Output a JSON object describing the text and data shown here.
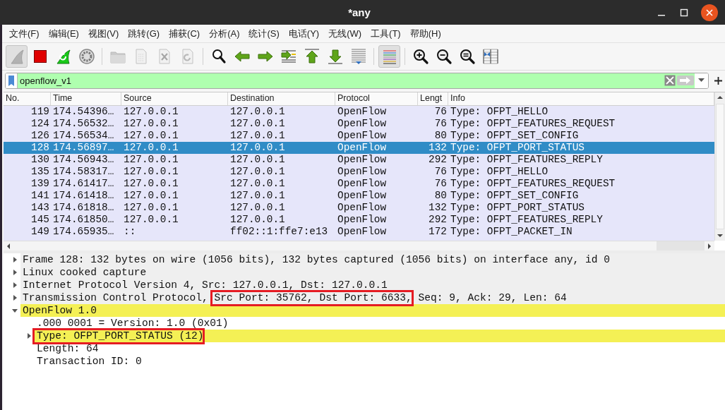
{
  "window": {
    "title": "*any"
  },
  "menu": [
    "文件(F)",
    "编辑(E)",
    "视图(V)",
    "跳转(G)",
    "捕获(C)",
    "分析(A)",
    "统计(S)",
    "电话(Y)",
    "无线(W)",
    "工具(T)",
    "帮助(H)"
  ],
  "toolbar": [
    {
      "kind": "start",
      "pressed": true,
      "disabled": true
    },
    {
      "kind": "stop",
      "pressed": false,
      "disabled": false
    },
    {
      "kind": "restart",
      "pressed": false,
      "disabled": false
    },
    {
      "kind": "options",
      "pressed": false,
      "disabled": false
    },
    {
      "kind": "separator"
    },
    {
      "kind": "open",
      "pressed": false,
      "disabled": true
    },
    {
      "kind": "save",
      "pressed": false,
      "disabled": true
    },
    {
      "kind": "close",
      "pressed": false,
      "disabled": true
    },
    {
      "kind": "reload",
      "pressed": false,
      "disabled": true
    },
    {
      "kind": "separator"
    },
    {
      "kind": "find",
      "pressed": false,
      "disabled": false
    },
    {
      "kind": "back",
      "pressed": false,
      "disabled": false
    },
    {
      "kind": "forward",
      "pressed": false,
      "disabled": false
    },
    {
      "kind": "goto",
      "pressed": false,
      "disabled": false
    },
    {
      "kind": "first",
      "pressed": false,
      "disabled": false
    },
    {
      "kind": "last",
      "pressed": false,
      "disabled": false
    },
    {
      "kind": "autoscroll",
      "pressed": false,
      "disabled": false
    },
    {
      "kind": "separator"
    },
    {
      "kind": "colorize",
      "pressed": true,
      "disabled": false
    },
    {
      "kind": "separator"
    },
    {
      "kind": "zoom-in",
      "pressed": false,
      "disabled": false
    },
    {
      "kind": "zoom-out",
      "pressed": false,
      "disabled": false
    },
    {
      "kind": "zoom-normal",
      "pressed": false,
      "disabled": false
    },
    {
      "kind": "resize-columns",
      "pressed": false,
      "disabled": false
    }
  ],
  "filter": {
    "value": "openflow_v1",
    "valid": true
  },
  "packet_list": {
    "columns": [
      "No.",
      "Time",
      "Source",
      "Destination",
      "Protocol",
      "Lengt",
      "Info"
    ],
    "rows": [
      {
        "cells": [
          "119",
          "174.54396…",
          "127.0.0.1",
          "127.0.0.1",
          "OpenFlow",
          "76",
          "Type: OFPT_HELLO"
        ],
        "selected": false
      },
      {
        "cells": [
          "124",
          "174.56532…",
          "127.0.0.1",
          "127.0.0.1",
          "OpenFlow",
          "76",
          "Type: OFPT_FEATURES_REQUEST"
        ],
        "selected": false
      },
      {
        "cells": [
          "126",
          "174.56534…",
          "127.0.0.1",
          "127.0.0.1",
          "OpenFlow",
          "80",
          "Type: OFPT_SET_CONFIG"
        ],
        "selected": false
      },
      {
        "cells": [
          "128",
          "174.56897…",
          "127.0.0.1",
          "127.0.0.1",
          "OpenFlow",
          "132",
          "Type: OFPT_PORT_STATUS"
        ],
        "selected": true
      },
      {
        "cells": [
          "130",
          "174.56943…",
          "127.0.0.1",
          "127.0.0.1",
          "OpenFlow",
          "292",
          "Type: OFPT_FEATURES_REPLY"
        ],
        "selected": false
      },
      {
        "cells": [
          "135",
          "174.58317…",
          "127.0.0.1",
          "127.0.0.1",
          "OpenFlow",
          "76",
          "Type: OFPT_HELLO"
        ],
        "selected": false
      },
      {
        "cells": [
          "139",
          "174.61417…",
          "127.0.0.1",
          "127.0.0.1",
          "OpenFlow",
          "76",
          "Type: OFPT_FEATURES_REQUEST"
        ],
        "selected": false
      },
      {
        "cells": [
          "141",
          "174.61418…",
          "127.0.0.1",
          "127.0.0.1",
          "OpenFlow",
          "80",
          "Type: OFPT_SET_CONFIG"
        ],
        "selected": false
      },
      {
        "cells": [
          "143",
          "174.61818…",
          "127.0.0.1",
          "127.0.0.1",
          "OpenFlow",
          "132",
          "Type: OFPT_PORT_STATUS"
        ],
        "selected": false
      },
      {
        "cells": [
          "145",
          "174.61850…",
          "127.0.0.1",
          "127.0.0.1",
          "OpenFlow",
          "292",
          "Type: OFPT_FEATURES_REPLY"
        ],
        "selected": false
      },
      {
        "cells": [
          "149",
          "174.65935…",
          "::",
          "ff02::1:ffe7:e13",
          "OpenFlow",
          "172",
          "Type: OFPT_PACKET_IN"
        ],
        "selected": false
      }
    ]
  },
  "details": [
    {
      "parts": [
        {
          "text": "Frame 128: 132 bytes on wire (1056 bits), 132 bytes captured (1056 bits) on interface any, id 0",
          "boxed": false
        }
      ],
      "expanded": false,
      "color": "#efefef"
    },
    {
      "parts": [
        {
          "text": "Linux cooked capture",
          "boxed": false
        }
      ],
      "expanded": false,
      "color": "#efefef"
    },
    {
      "parts": [
        {
          "text": "Internet Protocol Version 4, Src: 127.0.0.1, Dst: 127.0.0.1",
          "boxed": false
        }
      ],
      "expanded": false,
      "color": "#efefef"
    },
    {
      "parts": [
        {
          "text": "Transmission Control Protocol, ",
          "boxed": false
        },
        {
          "text": "Src Port: 35762, Dst Port: 6633,",
          "boxed": true
        },
        {
          "text": " Seq: 9, Ack: 29, Len: 64",
          "boxed": false
        }
      ],
      "expanded": false,
      "color": "#efefef"
    },
    {
      "parts": [
        {
          "text": "OpenFlow 1.0",
          "boxed": false
        }
      ],
      "expanded": true,
      "color": "#f4f055",
      "children": [
        {
          "parts": [
            {
              "text": ".000 0001 = Version: 1.0 (0x01)",
              "boxed": false
            }
          ],
          "color": "#ffffff"
        },
        {
          "parts": [
            {
              "text": "Type: OFPT_PORT_STATUS (12)",
              "boxed": true
            }
          ],
          "expanded": false,
          "color": "#f4f055"
        },
        {
          "parts": [
            {
              "text": "Length: 64",
              "boxed": false
            }
          ],
          "color": "#ffffff"
        },
        {
          "parts": [
            {
              "text": "Transaction ID: 0",
              "boxed": false
            }
          ],
          "color": "#ffffff"
        }
      ]
    }
  ]
}
